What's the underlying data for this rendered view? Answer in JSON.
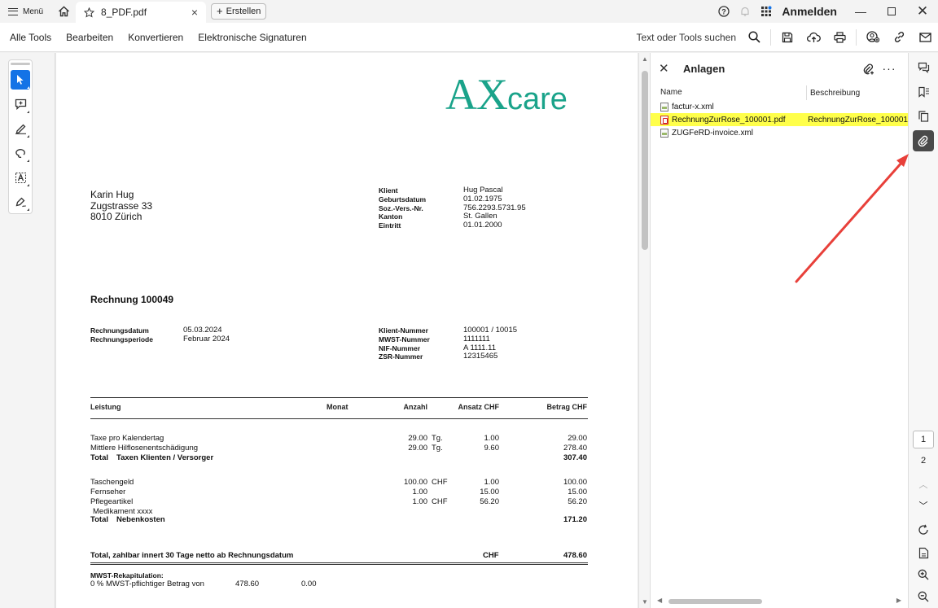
{
  "titlebar": {
    "menu_label": "Menü",
    "tab_title": "8_PDF.pdf",
    "create_label": "Erstellen",
    "sign_in": "Anmelden"
  },
  "toolbar": {
    "items": [
      "Alle Tools",
      "Bearbeiten",
      "Konvertieren",
      "Elektronische Signaturen"
    ],
    "search_label": "Text oder Tools suchen"
  },
  "document": {
    "logo_big": "AX",
    "logo_small": "care",
    "recipient": [
      "Karin Hug",
      "Zugstrasse 33",
      "8010 Zürich"
    ],
    "client_labels": [
      "Klient",
      "Geburtsdatum",
      "Soz.-Vers.-Nr.",
      "Kanton",
      "Eintritt"
    ],
    "client_values": [
      "Hug Pascal",
      "01.02.1975",
      "756.2293.5731.95",
      "St. Gallen",
      "01.01.2000"
    ],
    "invoice_title": "Rechnung 100049",
    "date_labels": [
      "Rechnungsdatum",
      "Rechnungsperiode"
    ],
    "date_values": [
      "05.03.2024",
      "Februar 2024"
    ],
    "ids_labels": [
      "Klient-Nummer",
      "MWST-Nummer",
      "NIF-Nummer",
      "ZSR-Nummer"
    ],
    "ids_values": [
      "100001 / 10015",
      "1111111",
      "A 1111.11",
      "12315465"
    ],
    "table_headers": {
      "service": "Leistung",
      "month": "Monat",
      "qty": "Anzahl",
      "rate": "Ansatz CHF",
      "amount": "Betrag CHF"
    },
    "section1_rows": [
      {
        "service": "Taxe pro Kalendertag",
        "qty": "29.00",
        "unit": "Tg.",
        "rate": "1.00",
        "amount": "29.00"
      },
      {
        "service": "Mittlere Hilflosenentschädigung",
        "qty": "29.00",
        "unit": "Tg.",
        "rate": "9.60",
        "amount": "278.40"
      }
    ],
    "section1_total": {
      "label": "Total",
      "name": "Taxen Klienten / Versorger",
      "amount": "307.40"
    },
    "section2_rows": [
      {
        "service": "Taschengeld",
        "qty": "100.00",
        "unit": "CHF",
        "rate": "1.00",
        "amount": "100.00"
      },
      {
        "service": "Fernseher",
        "qty": "1.00",
        "unit": "",
        "rate": "15.00",
        "amount": "15.00"
      },
      {
        "service": "Pflegeartikel",
        "qty": "1.00",
        "unit": "CHF",
        "rate": "56.20",
        "amount": "56.20"
      }
    ],
    "section2_note": "Medikament xxxx",
    "section2_total": {
      "label": "Total",
      "name": "Nebenkosten",
      "amount": "171.20"
    },
    "grand_total": {
      "label": "Total, zahlbar innert 30 Tage netto ab Rechnungsdatum",
      "currency": "CHF",
      "amount": "478.60"
    },
    "vat": {
      "title": "MWST-Rekapitulation:",
      "line_label": "0 % MWST-pflichtiger Betrag von",
      "amount": "478.60",
      "vat_value": "0.00"
    }
  },
  "attachments": {
    "title": "Anlagen",
    "columns": [
      "Name",
      "Beschreibung"
    ],
    "files": [
      {
        "name": "factur-x.xml",
        "description": "",
        "type": "xml",
        "selected": false
      },
      {
        "name": "RechnungZurRose_100001.pdf",
        "description": "RechnungZurRose_100001",
        "type": "pdf",
        "selected": true
      },
      {
        "name": "ZUGFeRD-invoice.xml",
        "description": "",
        "type": "xml",
        "selected": false
      }
    ]
  },
  "right_rail": {
    "pages": [
      "1",
      "2"
    ],
    "current_page": "1"
  },
  "colors": {
    "accent": "#1473e6",
    "logo": "#1aa38a",
    "highlight": "#ffff4a",
    "annotation_arrow": "#e8403a"
  }
}
